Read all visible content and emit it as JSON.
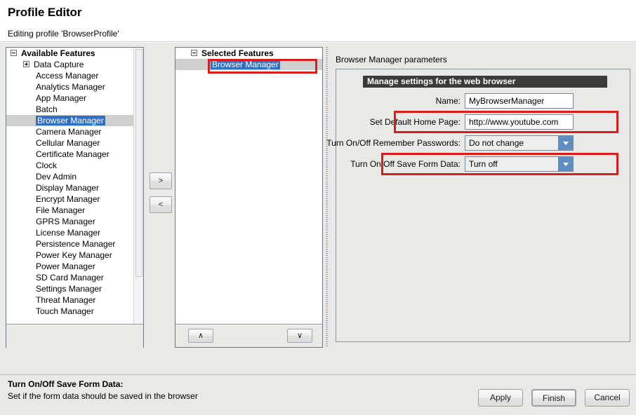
{
  "header": {
    "title": "Profile Editor",
    "subtitle": "Editing profile 'BrowserProfile'"
  },
  "available": {
    "root_label": "Available Features",
    "root_icon": "minus-box-icon",
    "items": [
      {
        "label": "Data Capture",
        "icon": "plus-box-icon",
        "expandable": true,
        "selected": false
      },
      {
        "label": "Access Manager",
        "icon": "",
        "expandable": false,
        "selected": false
      },
      {
        "label": "Analytics Manager",
        "icon": "",
        "expandable": false,
        "selected": false
      },
      {
        "label": "App Manager",
        "icon": "",
        "expandable": false,
        "selected": false
      },
      {
        "label": "Batch",
        "icon": "",
        "expandable": false,
        "selected": false
      },
      {
        "label": "Browser Manager",
        "icon": "",
        "expandable": false,
        "selected": true
      },
      {
        "label": "Camera Manager",
        "icon": "",
        "expandable": false,
        "selected": false
      },
      {
        "label": "Cellular Manager",
        "icon": "",
        "expandable": false,
        "selected": false
      },
      {
        "label": "Certificate Manager",
        "icon": "",
        "expandable": false,
        "selected": false
      },
      {
        "label": "Clock",
        "icon": "",
        "expandable": false,
        "selected": false
      },
      {
        "label": "Dev Admin",
        "icon": "",
        "expandable": false,
        "selected": false
      },
      {
        "label": "Display Manager",
        "icon": "",
        "expandable": false,
        "selected": false
      },
      {
        "label": "Encrypt Manager",
        "icon": "",
        "expandable": false,
        "selected": false
      },
      {
        "label": "File Manager",
        "icon": "",
        "expandable": false,
        "selected": false
      },
      {
        "label": "GPRS Manager",
        "icon": "",
        "expandable": false,
        "selected": false
      },
      {
        "label": "License Manager",
        "icon": "",
        "expandable": false,
        "selected": false
      },
      {
        "label": "Persistence Manager",
        "icon": "",
        "expandable": false,
        "selected": false
      },
      {
        "label": "Power Key Manager",
        "icon": "",
        "expandable": false,
        "selected": false
      },
      {
        "label": "Power Manager",
        "icon": "",
        "expandable": false,
        "selected": false
      },
      {
        "label": "SD Card Manager",
        "icon": "",
        "expandable": false,
        "selected": false
      },
      {
        "label": "Settings Manager",
        "icon": "",
        "expandable": false,
        "selected": false
      },
      {
        "label": "Threat Manager",
        "icon": "",
        "expandable": false,
        "selected": false
      },
      {
        "label": "Touch Manager",
        "icon": "",
        "expandable": false,
        "selected": false
      }
    ]
  },
  "transfer": {
    "add_label": ">",
    "remove_label": "<",
    "add_icon": "chevron-right-icon",
    "remove_icon": "chevron-left-icon"
  },
  "selected": {
    "root_label": "Selected Features",
    "root_icon": "minus-box-icon",
    "items": [
      {
        "label": "Browser Manager",
        "selected": true,
        "annotated": true
      }
    ],
    "move_up_label": "∧",
    "move_down_label": "∨",
    "move_up_icon": "caret-up-icon",
    "move_down_icon": "caret-down-icon"
  },
  "params": {
    "title": "Browser Manager parameters",
    "group_header": "Manage settings for the web browser",
    "rows": [
      {
        "label": "Name:",
        "type": "text",
        "value": "MyBrowserManager",
        "annotated": false
      },
      {
        "label": "Set Default Home Page:",
        "type": "text",
        "value": "http://www.youtube.com",
        "annotated": true
      },
      {
        "label": "Turn On/Off Remember Passwords:",
        "type": "combo",
        "value": "Do not change",
        "annotated": false
      },
      {
        "label": "Turn On/Off Save Form Data:",
        "type": "combo",
        "value": "Turn off",
        "annotated": true
      }
    ]
  },
  "description": {
    "title": "Turn On/Off Save Form Data:",
    "text": "Set if the form data should be saved in the browser"
  },
  "buttons": {
    "apply": "Apply",
    "finish": "Finish",
    "cancel": "Cancel"
  },
  "colors": {
    "annotation_red": "#d91d1d",
    "selection_blue": "#2f6fc4",
    "combo_arrow_blue": "#5e8ec6",
    "group_header_bg": "#3b3b39",
    "dialog_bg": "#e9e9e7"
  }
}
